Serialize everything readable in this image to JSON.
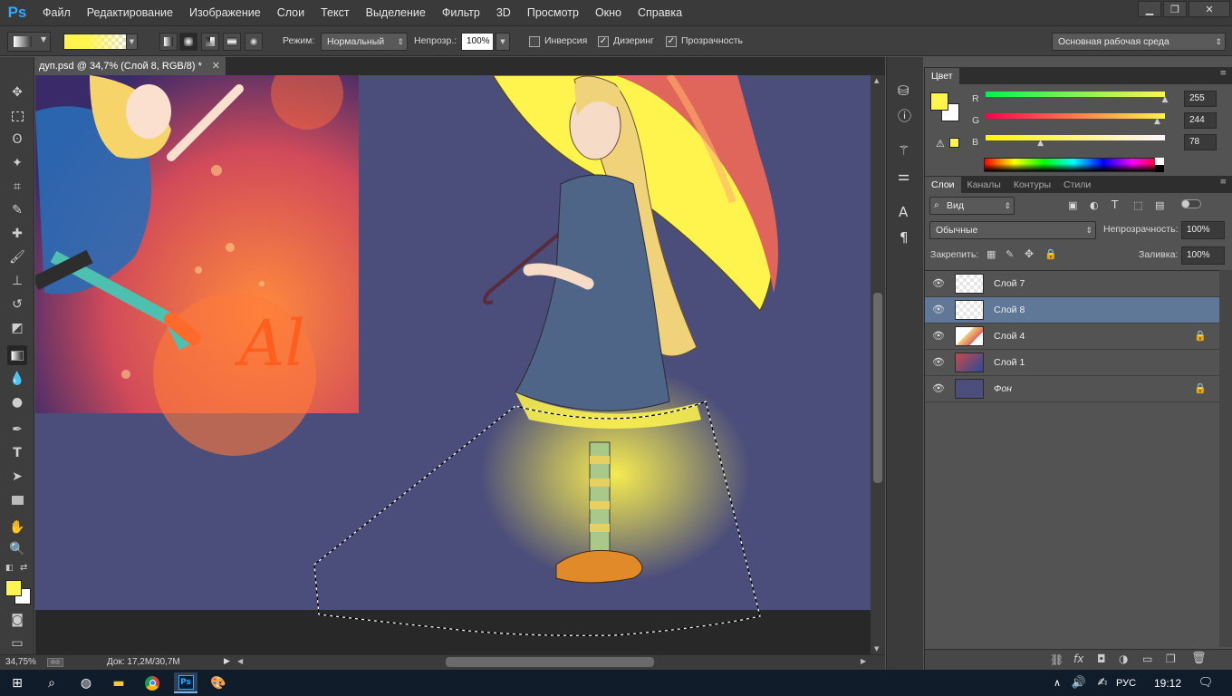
{
  "app": {
    "logo": "Ps"
  },
  "menu": [
    "Файл",
    "Редактирование",
    "Изображение",
    "Слои",
    "Текст",
    "Выделение",
    "Фильтр",
    "3D",
    "Просмотр",
    "Окно",
    "Справка"
  ],
  "options": {
    "mode_label": "Режим:",
    "mode_value": "Нормальный",
    "opacity_label": "Непрозр.:",
    "opacity_value": "100%",
    "inverse_label": "Инверсия",
    "dither_label": "Дизеринг",
    "transparency_label": "Прозрачность",
    "workspace": "Основная рабочая среда"
  },
  "document": {
    "tab_title": "дуп.psd @ 34,7% (Слой 8, RGB/8) *",
    "zoom": "34,75%",
    "doc_info": "Док: 17,2M/30,7M"
  },
  "color_panel": {
    "tab": "Цвет",
    "r_label": "R",
    "r_value": "255",
    "g_label": "G",
    "g_value": "244",
    "b_label": "B",
    "b_value": "78",
    "fg_color": "#fff44e",
    "r_fraction": 1.0,
    "g_fraction": 0.957,
    "b_fraction": 0.306
  },
  "layers_panel": {
    "tabs": [
      "Слои",
      "Каналы",
      "Контуры",
      "Стили"
    ],
    "filter": "Вид",
    "blend_mode": "Обычные",
    "opacity_label": "Непрозрачность:",
    "opacity_value": "100%",
    "lock_label": "Закрепить:",
    "fill_label": "Заливка:",
    "fill_value": "100%",
    "layers": [
      {
        "name": "Слой 7",
        "selected": false,
        "locked": false
      },
      {
        "name": "Слой 8",
        "selected": true,
        "locked": false
      },
      {
        "name": "Слой 4",
        "selected": false,
        "locked": true
      },
      {
        "name": "Слой 1",
        "selected": false,
        "locked": false
      },
      {
        "name": "Фон",
        "selected": false,
        "locked": true
      }
    ]
  },
  "taskbar": {
    "language": "РУС",
    "time": "19:12"
  },
  "colors": {
    "canvas_bg": "#4b4d7b",
    "accent_yellow": "#fff44e",
    "selected_layer": "#5f7897"
  }
}
